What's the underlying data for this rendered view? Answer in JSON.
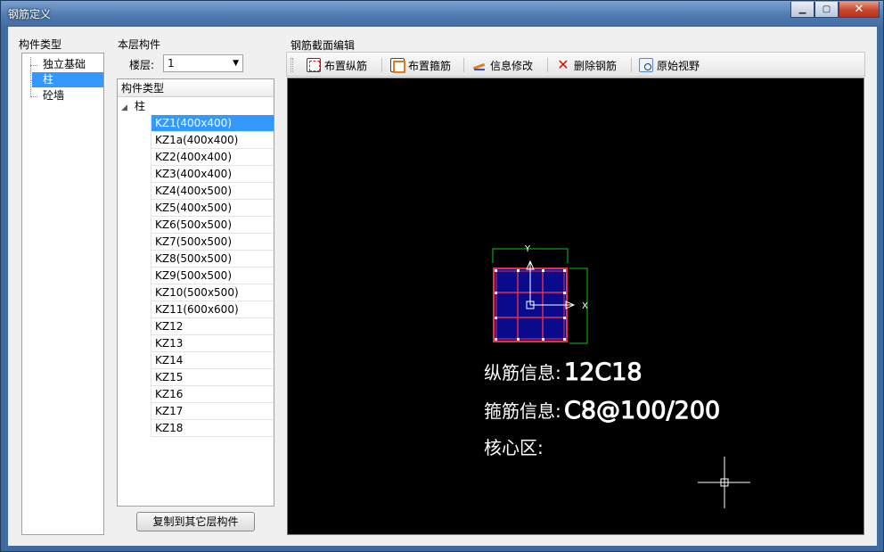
{
  "window": {
    "title": "钢筋定义"
  },
  "component_types": {
    "label": "构件类型",
    "items": [
      {
        "label": "独立基础",
        "selected": false
      },
      {
        "label": "柱",
        "selected": true
      },
      {
        "label": "砼墙",
        "selected": false
      }
    ]
  },
  "layer_components": {
    "label": "本层构件",
    "floor_label": "楼层:",
    "floor_value": "1",
    "list_header": "构件类型",
    "root_label": "柱",
    "items": [
      "KZ1(400x400)",
      "KZ1a(400x400)",
      "KZ2(400x400)",
      "KZ3(400x400)",
      "KZ4(400x500)",
      "KZ5(400x500)",
      "KZ6(500x500)",
      "KZ7(500x500)",
      "KZ8(500x500)",
      "KZ9(500x500)",
      "KZ10(500x500)",
      "KZ11(600x600)",
      "KZ12",
      "KZ13",
      "KZ14",
      "KZ15",
      "KZ16",
      "KZ17",
      "KZ18"
    ],
    "selected_index": 0,
    "copy_button": "复制到其它层构件"
  },
  "editor": {
    "label": "钢筋截面编辑",
    "toolbar": {
      "place_longitudinal": "布置纵筋",
      "place_stirrup": "布置箍筋",
      "edit_info": "信息修改",
      "delete_rebar": "删除钢筋",
      "original_view": "原始视野"
    },
    "canvas": {
      "longitudinal_label": "纵筋信息:",
      "longitudinal_value": "12C18",
      "stirrup_label": "箍筋信息:",
      "stirrup_value": "C8@100/200",
      "core_label": "核心区:",
      "axis_y": "Y",
      "axis_x": "X"
    }
  },
  "colors": {
    "selection": "#3399ff",
    "section_fill": "#0a0a8c",
    "stirrup": "#e0304a",
    "dimension": "#19c419",
    "canvas_bg": "#000000"
  }
}
